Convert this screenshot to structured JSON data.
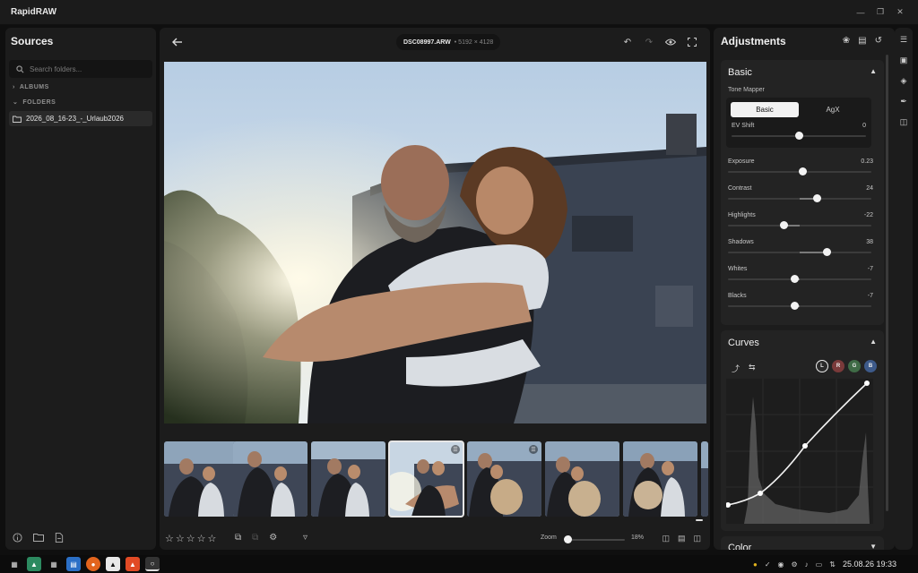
{
  "window": {
    "title": "RapidRAW"
  },
  "sources": {
    "title": "Sources",
    "search_placeholder": "Search folders...",
    "albums_label": "ALBUMS",
    "folders_label": "FOLDERS",
    "folder_item": "2026_08_16-23_-_Urlaub2026"
  },
  "viewer": {
    "file_name": "DSC08997.ARW",
    "file_dims": "• 5192 × 4128",
    "zoom_label": "Zoom",
    "zoom_value": "18%",
    "zoom_fraction": 0.0
  },
  "filmstrip": {
    "count": 7,
    "selected_index": 3
  },
  "adjustments": {
    "title": "Adjustments",
    "basic": {
      "title": "Basic",
      "tone_mapper_label": "Tone Mapper",
      "tone_options": [
        "Basic",
        "AgX"
      ],
      "ev_label": "EV Shift",
      "ev_value": "0",
      "sliders": [
        {
          "label": "Exposure",
          "value": "0.23",
          "pos": 0.52
        },
        {
          "label": "Contrast",
          "value": "24",
          "pos": 0.62
        },
        {
          "label": "Highlights",
          "value": "-22",
          "pos": 0.39
        },
        {
          "label": "Shadows",
          "value": "38",
          "pos": 0.69
        },
        {
          "label": "Whites",
          "value": "-7",
          "pos": 0.465
        },
        {
          "label": "Blacks",
          "value": "-7",
          "pos": 0.465
        }
      ]
    },
    "curves": {
      "title": "Curves",
      "channels": [
        "L",
        "R",
        "G",
        "B"
      ],
      "channel_colors": [
        "#2b2b2b",
        "#7a3a3a",
        "#3f6b46",
        "#3d5a8a"
      ]
    },
    "color": {
      "title": "Color"
    }
  },
  "taskbar": {
    "clock": "25.08.26 19:33"
  }
}
